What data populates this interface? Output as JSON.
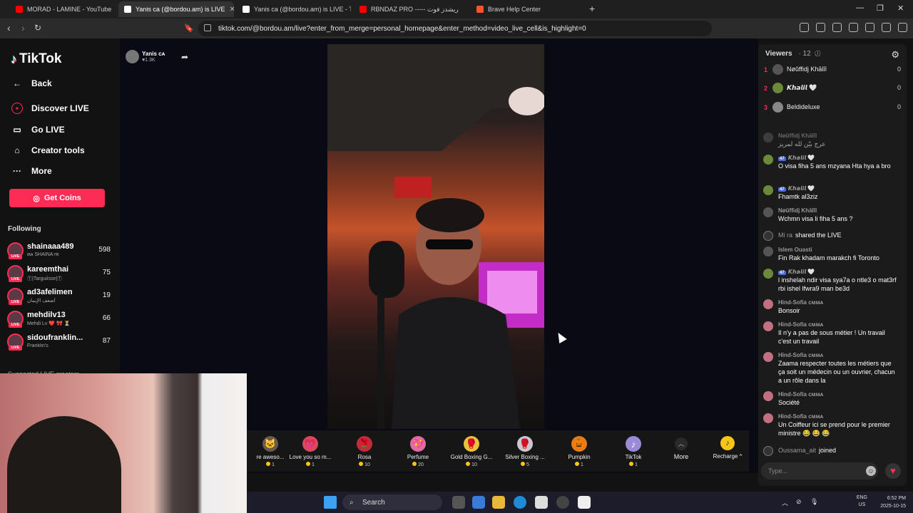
{
  "browser": {
    "tabs": [
      {
        "title": "MORAD - LAMINE - YouTube",
        "active": false,
        "favicon_color": "#ff0000"
      },
      {
        "title": "Yanis ca (@bordou.am) is LIVE",
        "active": true,
        "favicon_color": "#ffffff"
      },
      {
        "title": "Yanis ca (@bordou.am) is LIVE - T",
        "active": false,
        "favicon_color": "#ffffff"
      },
      {
        "title": "RBNDAZ PRO ----- ريشدز فوت",
        "active": false,
        "favicon_color": "#ff0000"
      },
      {
        "title": "Brave Help Center",
        "active": false,
        "favicon_color": "#fb542b"
      }
    ],
    "new_tab": "+",
    "url": "tiktok.com/@bordou.am/live?enter_from_merge=personal_homepage&enter_method=video_live_cell&is_highlight=0"
  },
  "sidebar": {
    "logo": "TikTok",
    "nav": [
      {
        "label": "Back",
        "icon": "arrow-left-icon"
      },
      {
        "label": "Discover LIVE",
        "icon": "live-icon"
      },
      {
        "label": "Go LIVE",
        "icon": "camera-icon"
      },
      {
        "label": "Creator tools",
        "icon": "home-icon"
      },
      {
        "label": "More",
        "icon": "more-icon"
      }
    ],
    "get_coins": "Get Coins",
    "following_title": "Following",
    "following": [
      {
        "name": "shainaaa489",
        "sub": "ʍᴀ SHAINA ғʀ",
        "count": "598"
      },
      {
        "name": "kareemthai",
        "sub": "Ⓣ|Targuiisse|Ⓣ",
        "count": "75"
      },
      {
        "name": "ad3afelimen",
        "sub": "أضعف الإيمان",
        "count": "19"
      },
      {
        "name": "mehdilv13",
        "sub": "Mehdi Lv ❤️ 🎀 ⏳",
        "count": "66"
      },
      {
        "name": "sidoufranklin...",
        "sub": "Franklin's",
        "count": "87"
      }
    ],
    "live_badge": "LIVE",
    "suggested_title": "Suggested LIVE creators"
  },
  "stream": {
    "host_name": "Yanis ᴄᴀ",
    "host_likes": "♥1.3K"
  },
  "gifts": [
    {
      "name": "re aweso...",
      "price": "1",
      "icon": "🐱",
      "bg": "#6a5a4a"
    },
    {
      "name": "Love you so m...",
      "price": "1",
      "icon": "💗",
      "bg": "#d94a5a"
    },
    {
      "name": "Rosa",
      "price": "10",
      "icon": "🌹",
      "bg": "#c42a3a"
    },
    {
      "name": "Perfume",
      "price": "20",
      "icon": "💖",
      "bg": "#e46aa6"
    },
    {
      "name": "Gold Boxing G...",
      "price": "10",
      "icon": "🥊",
      "bg": "#e8c23a"
    },
    {
      "name": "Silver Boxing ...",
      "price": "5",
      "icon": "🥊",
      "bg": "#c8c8d0"
    },
    {
      "name": "Pumpkin",
      "price": "1",
      "icon": "🎃",
      "bg": "#e87a1a"
    },
    {
      "name": "TikTok",
      "price": "1",
      "icon": "♪",
      "bg": "#9a8ad8"
    }
  ],
  "gift_more": "More",
  "recharge": "Recharge ^",
  "chat": {
    "viewers_label": "Viewers",
    "viewers_count": "· 12",
    "ranking": [
      {
        "rank": "1",
        "name": "Nøŭffidj Khālīl",
        "score": "0"
      },
      {
        "rank": "2",
        "name": "𝙆𝙝𝙖𝙡𝙞𝙡 🤍",
        "score": "0"
      },
      {
        "rank": "3",
        "name": "Beldideluxe",
        "score": "0"
      }
    ],
    "messages": [
      {
        "user": "Nøŭffidj Khālīl",
        "badge": "",
        "text": "عرج بيّن لله لمريز"
      },
      {
        "user": "𝙆𝙝𝙖𝙡𝙞𝙡 🤍",
        "badge": "47",
        "text": "O visa fiha 5 ans mzyana Hta hya a bro"
      },
      {
        "user": "𝙆𝙝𝙖𝙡𝙞𝙡 🤍",
        "badge": "47",
        "text": "Fhamtk al3ziz"
      },
      {
        "user": "Nøŭffidj Khālīl",
        "badge": "",
        "text": "Wchmn visa li fiha 5 ans ?"
      },
      {
        "user": "Mi ra",
        "badge": "",
        "text": "shared the LIVE",
        "system": true
      },
      {
        "user": "Islem Ouasti",
        "badge": "",
        "text": "Fin Rak khadam marakch fi Toronto"
      },
      {
        "user": "𝙆𝙝𝙖𝙡𝙞𝙡 🤍",
        "badge": "47",
        "text": "l inshelah ndir visa sya7a o ntle3 o mat3rf rbi ishel lfwra9 man be3d"
      },
      {
        "user": "Hind-Sofia ᴄᴍᴍᴀ",
        "badge": "",
        "text": "Bonsoir"
      },
      {
        "user": "Hind-Sofia ᴄᴍᴍᴀ",
        "badge": "",
        "text": "Il n'y a pas de sous métier ! Un travail c'est un travail"
      },
      {
        "user": "Hind-Sofia ᴄᴍᴍᴀ",
        "badge": "",
        "text": "Zaama respecter toutes les métiers que ça soit un médecin ou un ouvrier, chacun a un rôle dans la"
      },
      {
        "user": "Hind-Sofia ᴄᴍᴍᴀ",
        "badge": "",
        "text": "Société"
      },
      {
        "user": "Hind-Sofia ᴄᴍᴍᴀ",
        "badge": "",
        "text": "Un Coiffeur ici se prend pour le premier ministre 😂 😂 😂"
      },
      {
        "user": "Oussama_ait",
        "badge": "",
        "text": "joined",
        "system": true
      }
    ],
    "input_placeholder": "Type..."
  },
  "taskbar": {
    "search": "Search",
    "lang": "ENG",
    "region": "US",
    "time": "6:52 PM",
    "date": "2025-10-15"
  }
}
